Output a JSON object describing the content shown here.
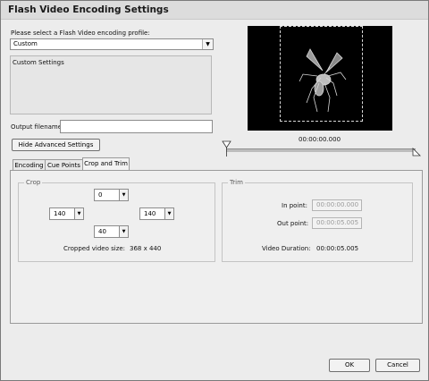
{
  "window": {
    "title": "Flash Video Encoding Settings"
  },
  "profile": {
    "prompt": "Please select a Flash Video encoding profile:",
    "selected": "Custom",
    "group_title": "Custom Settings"
  },
  "output": {
    "label": "Output filename:",
    "value": ""
  },
  "advanced_button": "Hide Advanced Settings",
  "preview": {
    "timecode": "00:00:00.000"
  },
  "tabs": [
    {
      "label": "Encoding",
      "active": false
    },
    {
      "label": "Cue Points",
      "active": false
    },
    {
      "label": "Crop and Trim",
      "active": true
    }
  ],
  "crop": {
    "legend": "Crop",
    "top": "0",
    "left": "140",
    "right": "140",
    "bottom": "40",
    "size_label": "Cropped video size:",
    "size_value": "368 x 440"
  },
  "trim": {
    "legend": "Trim",
    "in_label": "In point:",
    "in_value": "00:00:00.000",
    "out_label": "Out point:",
    "out_value": "00:00:05.005",
    "duration_label": "Video Duration:",
    "duration_value": "00:00:05.005"
  },
  "buttons": {
    "ok": "OK",
    "cancel": "Cancel"
  },
  "icons": {
    "dropdown": "chevron-down-icon",
    "slider_handle": "triangle-marker-icon"
  }
}
